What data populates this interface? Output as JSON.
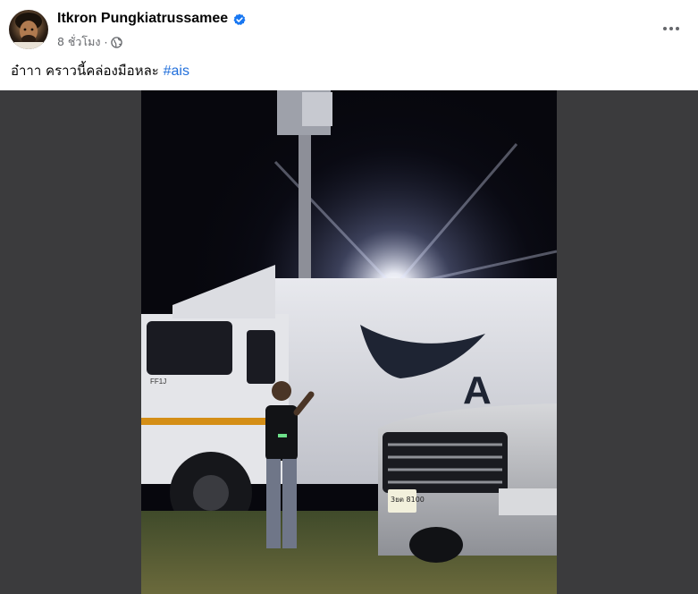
{
  "post": {
    "author": "Itkron Pungkiatrussamee",
    "verified": true,
    "time": "8 ชั่วโมง",
    "separator": "·",
    "audience_icon": "globe-icon",
    "more_icon": "more-horizontal-icon",
    "caption_text": "อ๋าาา คราวนี้คล่องมือหละ",
    "hashtag": "#ais",
    "photo": {
      "truck_logo_text": "A",
      "license_plate": "3ยต 8100",
      "truck_cab_badge": "FF1J"
    }
  },
  "colors": {
    "verified_badge": "#1877f2",
    "hashtag": "#216fdb",
    "media_background": "#3b3b3d"
  }
}
